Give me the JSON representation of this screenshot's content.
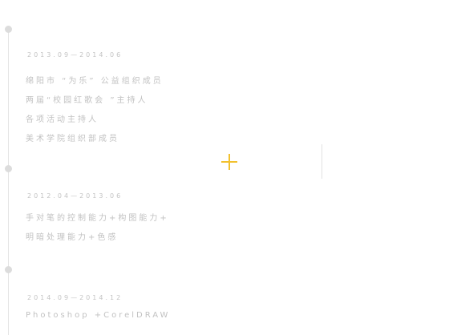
{
  "timeline": {
    "sections": [
      {
        "date": "2013.09—2014.06",
        "items": [
          "绵阳市 “为乐” 公益组织成员",
          "两届“校园红歌会 ”主持人",
          "各项活动主持人",
          "美术学院组织部成员"
        ]
      },
      {
        "date": "2012.04—2013.06",
        "items": [
          "手对笔的控制能力+构图能力+",
          "明暗处理能力+色感"
        ]
      },
      {
        "date": "2014.09—2014.12",
        "items": [
          "Photoshop  +CorelDRAW"
        ]
      }
    ]
  },
  "colors": {
    "accent": "#f2c12e",
    "text": "#c2c2c2",
    "line": "#e4e4e4"
  },
  "icons": {
    "center": "plus-icon"
  }
}
